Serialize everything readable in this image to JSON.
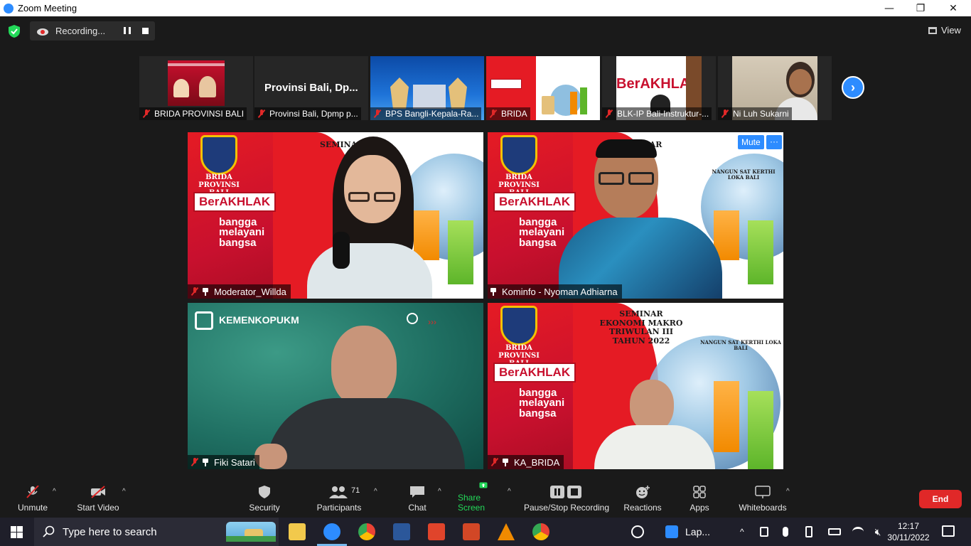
{
  "window": {
    "title": "Zoom Meeting"
  },
  "recording": {
    "label": "Recording..."
  },
  "view": {
    "label": "View"
  },
  "strip": [
    {
      "name": "BRIDA PROVINSI BALI"
    },
    {
      "name": "Provinsi Bali, Dpmp p...",
      "center_text": "Provinsi  Bali,  Dp..."
    },
    {
      "name": "BPS Bangli-Kepala-Ra..."
    },
    {
      "name": "BRIDA"
    },
    {
      "name": "BLK-IP Bali-Instruktur-..."
    },
    {
      "name": "Ni Luh Sukarni"
    }
  ],
  "tiles": {
    "moderator": {
      "name": "Moderator_Willda"
    },
    "kominfo": {
      "name": "Kominfo - Nyoman Adhiarna",
      "mute": "Mute",
      "more": "···"
    },
    "fiki": {
      "name": "Fiki Satari",
      "logo_text": "KEMENKOPUKM"
    },
    "ka_brida": {
      "name": "KA_BRIDA"
    }
  },
  "slide": {
    "brida": "BRIDA",
    "provinsi": "PROVINSI BALI",
    "berakhlak": "BerAKHLAK",
    "bangga_1": "bangga",
    "bangga_2": "melayani",
    "bangga_3": "bangsa",
    "seminar_1": "SEMINAR",
    "seminar_2": "EKONOMI MAKRO",
    "seminar_3": "TRIWULAN III",
    "seminar_4": "TAHUN 2022",
    "nangun": "NANGUN SAT KERTHI LOKA BALI"
  },
  "toolbar": {
    "unmute": "Unmute",
    "start_video": "Start Video",
    "security": "Security",
    "participants": "Participants",
    "participants_count": "71",
    "chat": "Chat",
    "share_screen": "Share Screen",
    "pause_stop_recording": "Pause/Stop Recording",
    "reactions": "Reactions",
    "apps": "Apps",
    "whiteboards": "Whiteboards",
    "end": "End"
  },
  "taskbar": {
    "search_placeholder": "Type here to search",
    "tray_app": "Lap...",
    "time": "12:17",
    "date": "30/11/2022"
  },
  "colors": {
    "accent": "#2d8cff",
    "end": "#e02828",
    "share": "#23d959",
    "slide_red": "#e51b24"
  }
}
